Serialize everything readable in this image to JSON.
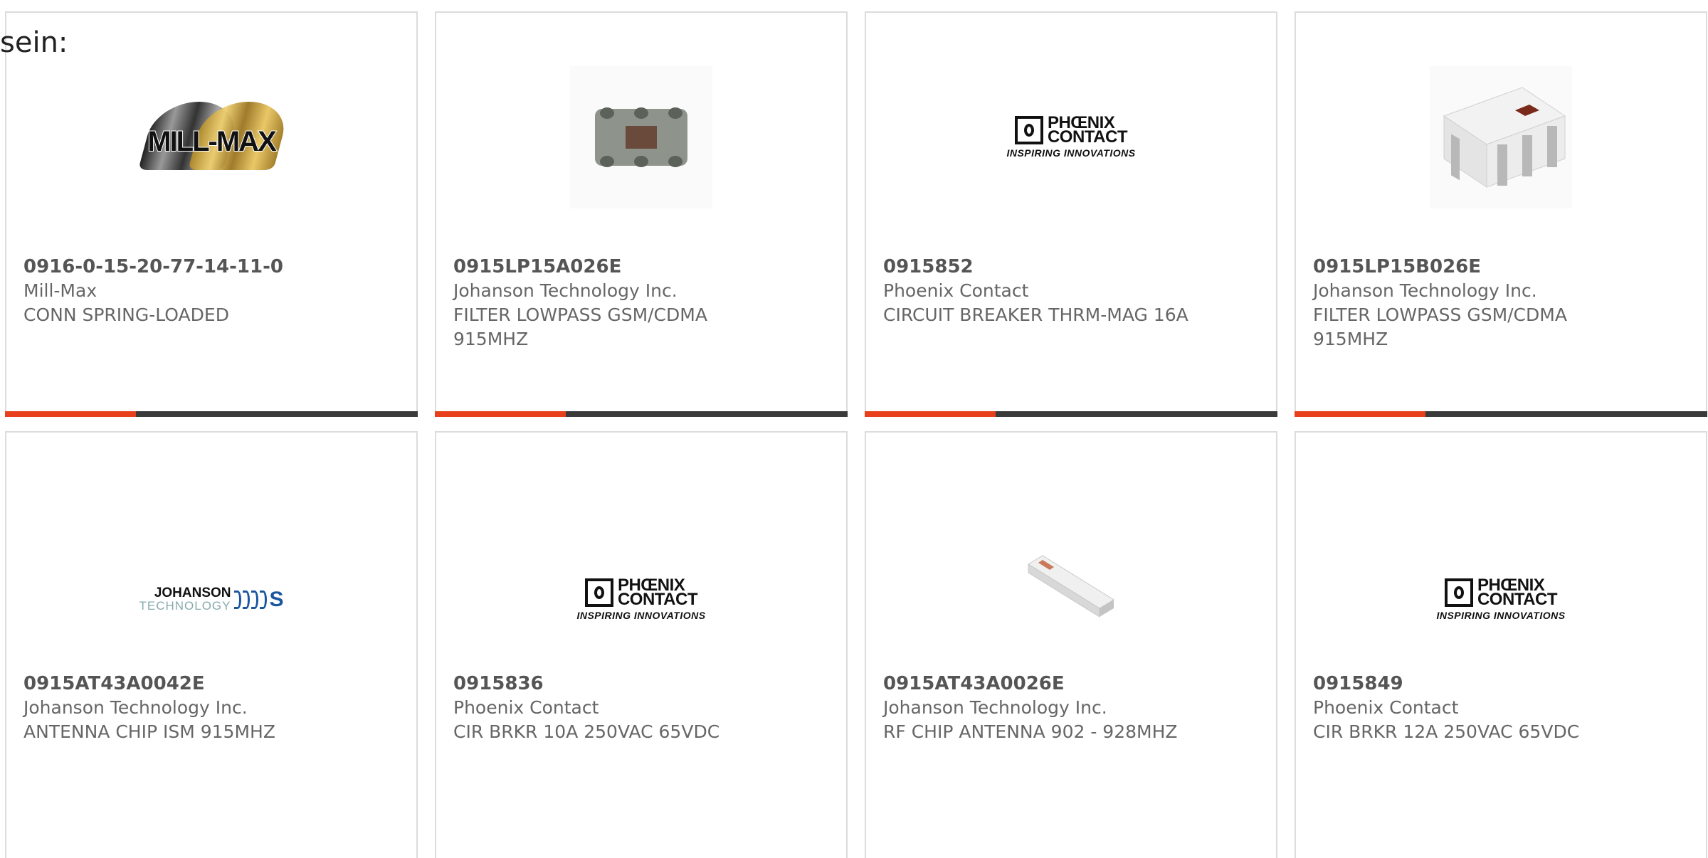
{
  "intro_text": "sein:",
  "colors": {
    "accent": "#e8401c",
    "bar": "#3a3a3a",
    "border": "#dcdcdc"
  },
  "products": [
    {
      "part_number": "0916-0-15-20-77-14-11-0",
      "manufacturer": "Mill-Max",
      "description": "CONN SPRING-LOADED",
      "image": "mill-max-logo"
    },
    {
      "part_number": "0915LP15A026E",
      "manufacturer": "Johanson Technology Inc.",
      "description": "FILTER LOWPASS GSM/CDMA 915MHZ",
      "image": "filter-chip-photo-top"
    },
    {
      "part_number": "0915852",
      "manufacturer": "Phoenix Contact",
      "description": "CIRCUIT BREAKER THRM-MAG 16A",
      "image": "phoenix-contact-logo"
    },
    {
      "part_number": "0915LP15B026E",
      "manufacturer": "Johanson Technology Inc.",
      "description": "FILTER LOWPASS GSM/CDMA 915MHZ",
      "image": "filter-chip-photo-iso"
    },
    {
      "part_number": "0915AT43A0042E",
      "manufacturer": "Johanson Technology Inc.",
      "description": "ANTENNA CHIP ISM 915MHZ",
      "image": "johanson-technology-logo"
    },
    {
      "part_number": "0915836",
      "manufacturer": "Phoenix Contact",
      "description": "CIR BRKR 10A 250VAC 65VDC",
      "image": "phoenix-contact-logo"
    },
    {
      "part_number": "0915AT43A0026E",
      "manufacturer": "Johanson Technology Inc.",
      "description": "RF CHIP ANTENNA 902 - 928MHZ",
      "image": "antenna-chip-photo"
    },
    {
      "part_number": "0915849",
      "manufacturer": "Phoenix Contact",
      "description": "CIR BRKR 12A 250VAC 65VDC",
      "image": "phoenix-contact-logo"
    }
  ],
  "logos": {
    "millmax": "MILL-MAX",
    "phoenix_line1": "PHŒNIX",
    "phoenix_line2": "CONTACT",
    "phoenix_tag": "INSPIRING INNOVATIONS",
    "johanson_line1": "JOHANSON",
    "johanson_line2": "TECHNOLOGY",
    "johanson_s": "S"
  }
}
